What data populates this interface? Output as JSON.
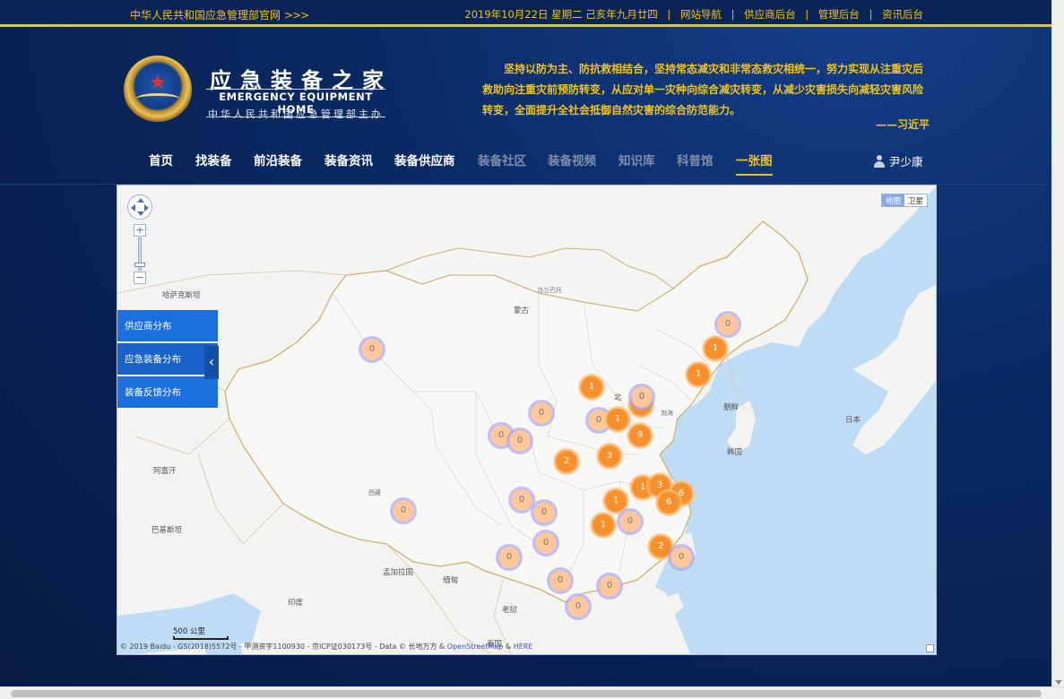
{
  "topbar": {
    "site_link": "中华人民共和国应急管理部官网",
    "site_arrows": ">>>",
    "date": "2019年10月22日 星期二 己亥年九月廿四",
    "links": [
      "网站导航",
      "供应商后台",
      "管理后台",
      "资讯后台"
    ],
    "separator": "|"
  },
  "brand": {
    "cn": "应急装备之家",
    "en": "EMERGENCY EQUIPMENT HOME",
    "sub": "中华人民共和国应急管理部主办"
  },
  "quote": {
    "text": "坚持以防为主、防抗救相结合，坚持常态减灾和非常态救灾相统一，努力实现从注重灾后救助向注重灾前预防转变，从应对单一灾种向综合减灾转变，从减少灾害损失向减轻灾害风险转变，全面提升全社会抵御自然灾害的综合防范能力。",
    "author": "——习近平"
  },
  "nav": {
    "items": [
      "首页",
      "找装备",
      "前沿装备",
      "装备资讯",
      "装备供应商",
      "装备社区",
      "装备视频",
      "知识库",
      "科普馆",
      "一张图"
    ],
    "active_index": 9,
    "user": "尹少康"
  },
  "map": {
    "type_buttons": [
      "地图",
      "卫星"
    ],
    "side_buttons": [
      "供应商分布",
      "应急装备分布",
      "装备反馈分布"
    ],
    "labels": {
      "kazakhstan": "哈萨克斯坦",
      "mongolia": "蒙古",
      "ulaanbaatar": "乌兰巴托",
      "afghanistan": "阿富汗",
      "pakistan": "巴基斯坦",
      "bangladesh": "孟加拉国",
      "myanmar": "缅甸",
      "india": "印度",
      "laos": "老挝",
      "thailand": "泰国",
      "korea_n": "朝鲜",
      "korea_s": "韩国",
      "japan": "日本",
      "beijing": "北",
      "tibet": "西藏",
      "bohai": "渤海"
    },
    "clusters": [
      {
        "label": "0"
      },
      {
        "label": "0"
      },
      {
        "label": "1"
      },
      {
        "label": "1"
      },
      {
        "label": "1"
      },
      {
        "label": "0"
      },
      {
        "label": "0"
      },
      {
        "label": "1"
      },
      {
        "label": "1"
      },
      {
        "label": "0"
      },
      {
        "label": "9"
      },
      {
        "label": "0"
      },
      {
        "label": "0"
      },
      {
        "label": "2"
      },
      {
        "label": "3"
      },
      {
        "label": "1"
      },
      {
        "label": "3"
      },
      {
        "label": "6"
      },
      {
        "label": "0"
      },
      {
        "label": "1"
      },
      {
        "label": "6"
      },
      {
        "label": "0"
      },
      {
        "label": "1"
      },
      {
        "label": "0"
      },
      {
        "label": "0"
      },
      {
        "label": "0"
      },
      {
        "label": "2"
      },
      {
        "label": "0"
      },
      {
        "label": "0"
      },
      {
        "label": "0"
      },
      {
        "label": "0"
      },
      {
        "label": "0"
      }
    ],
    "scale": "500 公里",
    "copyright": "© 2019 Baidu - GS(2018)5572号 - 甲测资字1100930 - 京ICP证030173号 - Data © 长地万方 & ",
    "osm": "OpenStreetMap",
    "amp": " & ",
    "here": "HERE"
  }
}
